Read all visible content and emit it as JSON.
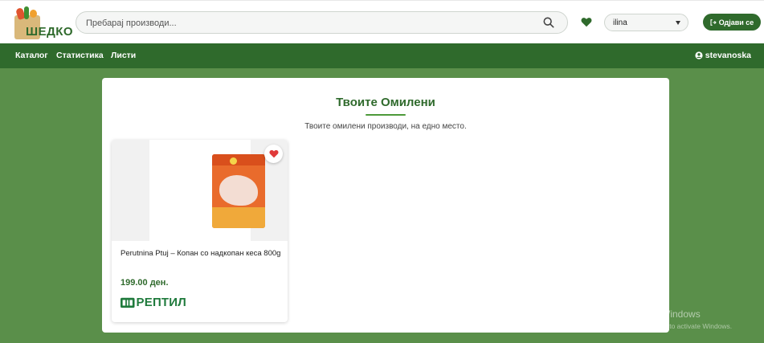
{
  "header": {
    "logo_text": "ШЕДКО",
    "search_placeholder": "Пребарај производи...",
    "select_value": "ilina",
    "logout_label": "Одјави се"
  },
  "nav": {
    "items": [
      "Каталог",
      "Статистика",
      "Листи"
    ],
    "username": "stevanoska"
  },
  "favorites": {
    "title": "Твоите Омилени",
    "subtitle": "Твоите омилени производи, на едно место."
  },
  "products": [
    {
      "name": "Perutnina Ptuj – Копан со надкопан кеса 800g",
      "price": "199.00 ден.",
      "store": "РЕПТИЛ",
      "favorited": true
    }
  ],
  "watermark": {
    "title": "Activate Windows",
    "subtitle": "Go to Settings to activate Windows."
  },
  "colors": {
    "brand_green": "#2f6a2c",
    "page_bg": "#5a8f4a",
    "heart_red": "#e03a3a",
    "store_green": "#1f7a3c"
  },
  "icons": [
    "search-icon",
    "heart-icon",
    "chevron-down-icon",
    "logout-icon",
    "user-circle-icon",
    "store-logo-icon"
  ]
}
